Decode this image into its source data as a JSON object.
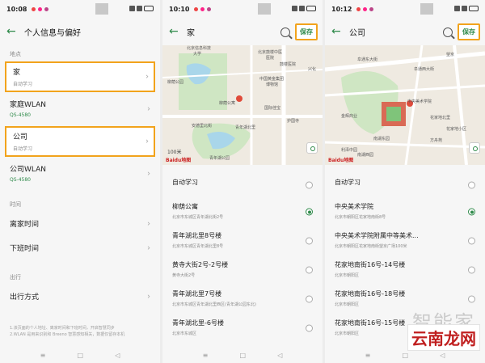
{
  "p1": {
    "time": "10:08",
    "title": "个人信息与偏好",
    "section_place": "地点",
    "home": {
      "name": "家",
      "sub": "自动学习"
    },
    "home_wlan": {
      "name": "家庭WLAN",
      "sub": "QS-4580"
    },
    "company": {
      "name": "公司",
      "sub": "自动学习"
    },
    "company_wlan": {
      "name": "公司WLAN",
      "sub": "QS-4580"
    },
    "section_time": "时间",
    "leave_home": "离家时间",
    "off_work": "下班时间",
    "section_travel": "出行",
    "travel_mode": "出行方式",
    "note1": "1.该页面的个人地址、离家时间和下班时间，开启智慧同步",
    "note2": "2.WLAN 是用来识别和 Breeno 智慧感知相关，数据仅留存本机"
  },
  "p2": {
    "time": "10:10",
    "title": "家",
    "save": "保存",
    "map_labels": [
      "北京信息科技",
      "大学",
      "北京鼓楼中医",
      "医院",
      "鼓楼医院",
      "柳荫公园",
      "柳荫公寓",
      "中国黄金集团",
      "博物馆",
      "国际佳宝",
      "护国寺",
      "安德里北街",
      "青年湖北里",
      "青年湖公园",
      "兴化"
    ],
    "scale": "100米",
    "logo": "Baidu地图",
    "options": [
      {
        "name": "自动学习",
        "sub": "",
        "selected": false
      },
      {
        "name": "柳荫公寓",
        "sub": "北京市东城区青年湖北街2号",
        "selected": true
      },
      {
        "name": "青年湖北里8号楼",
        "sub": "北京市东城区青年湖北里8号",
        "selected": false
      },
      {
        "name": "黄寺大街2号-2号楼",
        "sub": "黄寺大街2号",
        "selected": false
      },
      {
        "name": "青年湖北里7号楼",
        "sub": "北京市东城区青年湖北里西区(青年湖公园东北)",
        "selected": false
      },
      {
        "name": "青年湖北里-6号楼",
        "sub": "北京市东城区",
        "selected": false
      }
    ]
  },
  "p3": {
    "time": "10:12",
    "title": "公司",
    "save": "保存",
    "map_labels": [
      "望京",
      "阜通东大街",
      "阜通西大街",
      "中央美术学院",
      "金辉商业",
      "花家地北里",
      "花家地小区",
      "南湖东园",
      "方舟苑",
      "利泽中园",
      "南湖西园"
    ],
    "logo": "Baidu地图",
    "options": [
      {
        "name": "自动学习",
        "sub": "",
        "selected": false
      },
      {
        "name": "中央美术学院",
        "sub": "北京市朝阳区花家地南街8号",
        "selected": true
      },
      {
        "name": "中央美术学院附属中等美术...",
        "sub": "北京市朝阳区花家地南街望京广场100米",
        "selected": false
      },
      {
        "name": "花家地南街16号-14号楼",
        "sub": "北京市朝阳区",
        "selected": false
      },
      {
        "name": "花家地南街16号-18号楼",
        "sub": "北京市朝阳区",
        "selected": false
      },
      {
        "name": "花家地南街16号-15号楼",
        "sub": "北京市朝阳区",
        "selected": false
      }
    ]
  },
  "watermark": {
    "grey": "智能家",
    "red": "云南龙网"
  },
  "colors": {
    "accent": "#2f8a4a",
    "highlight": "#f2a31c",
    "map_bg": "#efeae1",
    "park": "#cfe6c3",
    "water": "#a9d6ea"
  }
}
